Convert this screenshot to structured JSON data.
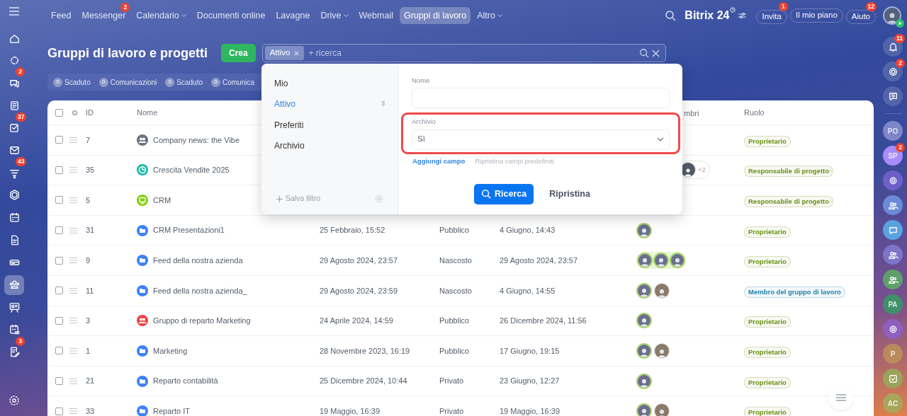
{
  "top_nav": [
    {
      "label": "Feed",
      "selected": false
    },
    {
      "label": "Messenger",
      "selected": false,
      "badge": "2"
    },
    {
      "label": "Calendario",
      "selected": false,
      "dropdown": true
    },
    {
      "label": "Documenti online",
      "selected": false
    },
    {
      "label": "Lavagne",
      "selected": false
    },
    {
      "label": "Drive",
      "selected": false,
      "dropdown": true
    },
    {
      "label": "Webmail",
      "selected": false
    },
    {
      "label": "Gruppi di lavoro",
      "selected": true
    },
    {
      "label": "Altro",
      "selected": false,
      "dropdown": true
    }
  ],
  "logo": {
    "name": "Bitrix",
    "number": "24"
  },
  "header_buttons": [
    {
      "label": "Invita",
      "badge": "1"
    },
    {
      "label": "Il mio piano"
    },
    {
      "label": "Aiuto",
      "badge": "12"
    }
  ],
  "left_sidebar": [
    {
      "kind": "home",
      "selected": false
    },
    {
      "kind": "sync",
      "selected": false
    },
    {
      "kind": "chat",
      "selected": false,
      "badge": "2"
    },
    {
      "kind": "news",
      "selected": false
    },
    {
      "kind": "tasks",
      "selected": false,
      "badge": "37"
    },
    {
      "kind": "mail",
      "selected": false
    },
    {
      "kind": "funnel",
      "selected": false,
      "badge": "43"
    },
    {
      "kind": "hexagon",
      "selected": false
    },
    {
      "kind": "calendar",
      "selected": false
    },
    {
      "kind": "document",
      "selected": false
    },
    {
      "kind": "drive",
      "selected": false
    },
    {
      "kind": "groups",
      "selected": true
    },
    {
      "kind": "board",
      "selected": false
    },
    {
      "kind": "schedule",
      "selected": false
    },
    {
      "kind": "sign",
      "selected": false,
      "badge": "3"
    }
  ],
  "page_title": "Gruppi di lavoro e progetti",
  "create_button": "Crea",
  "search": {
    "tag": "Attivo",
    "placeholder": "+ ricerca"
  },
  "counters": [
    {
      "value": "0",
      "label": "Scaduto"
    },
    {
      "value": "0",
      "label": "Comunicazioni"
    },
    {
      "value": "0",
      "label": "Scaduto"
    },
    {
      "value": "0",
      "label": "Comunica"
    }
  ],
  "filter_popup": {
    "presets": [
      {
        "label": "Mio",
        "selected": false
      },
      {
        "label": "Attivo",
        "selected": true
      },
      {
        "label": "Preferiti",
        "selected": false
      },
      {
        "label": "Archivio",
        "selected": false
      }
    ],
    "save_filter": "Salva filtro",
    "fields": [
      {
        "kind": "text",
        "label": "Nome",
        "highlighted": false
      },
      {
        "kind": "select",
        "label": "Archivio",
        "value": "Sì",
        "highlighted": true
      }
    ],
    "add_field": "Aggiungi campo",
    "reset_fields": "Ripristina campi predefiniti",
    "search_button": "Ricerca",
    "reset_button": "Ripristina"
  },
  "table": {
    "select_all_checked": false,
    "columns": [
      "ID",
      "Nome",
      "mbri",
      "Ruolo"
    ],
    "rows": [
      {
        "checked": false,
        "id": "7",
        "name": "Company news: the Vibe",
        "kind": "people",
        "color": "#6b7280",
        "role": {
          "text": "Proprietario",
          "color": "#6a8f12"
        },
        "members": []
      },
      {
        "checked": false,
        "id": "35",
        "name": "Crescita Vendite 2025",
        "kind": "chart",
        "color": "#14b8a6",
        "role": {
          "text": "Responsabile di progetto",
          "color": "#6a8f12"
        },
        "members": [
          {
            "highlighted": false,
            "kind": "silhouette"
          }
        ],
        "more": "+2"
      },
      {
        "checked": false,
        "id": "5",
        "name": "CRM",
        "kind": "screen",
        "color": "#84cc16",
        "role": {
          "text": "Responsabile di progetto",
          "color": "#6a8f12"
        },
        "members": []
      },
      {
        "checked": false,
        "id": "31",
        "name": "CRM Presentazioni1",
        "kind": "folder",
        "color": "#3b82f6",
        "created": "25 Febbraio, 15:52",
        "type": "Pubblico",
        "activity": "4 Giugno, 14:43",
        "role": {
          "text": "Proprietario",
          "color": "#6a8f12"
        },
        "members": [
          {
            "highlighted": true,
            "kind": "person"
          }
        ]
      },
      {
        "checked": false,
        "id": "9",
        "name": "Feed della nostra azienda",
        "kind": "folder",
        "color": "#3b82f6",
        "created": "29 Agosto 2024, 23:57",
        "type": "Nascosto",
        "activity": "29 Agosto 2024, 23:57",
        "role": {
          "text": "Proprietario",
          "color": "#6a8f12"
        },
        "members": [
          {
            "highlighted": true,
            "kind": "person"
          },
          {
            "highlighted": true,
            "kind": "person"
          },
          {
            "highlighted": true,
            "kind": "person"
          }
        ]
      },
      {
        "checked": false,
        "id": "11",
        "name": "Feed della nostra azienda_",
        "kind": "folder",
        "color": "#3b82f6",
        "created": "29 Agosto 2024, 23:59",
        "type": "Nascosto",
        "activity": "4 Giugno, 14:55",
        "role": {
          "text": "Membro del gruppo di lavoro",
          "color": "#1d7fa8"
        },
        "members": [
          {
            "highlighted": true,
            "kind": "person"
          },
          {
            "highlighted": false,
            "kind": "person"
          }
        ]
      },
      {
        "checked": false,
        "id": "3",
        "name": "Gruppo di reparto Marketing",
        "kind": "people",
        "color": "#ef4444",
        "created": "24 Aprile 2024, 14:59",
        "type": "Pubblico",
        "activity": "26 Dicembre 2024, 11:56",
        "role": {
          "text": "Proprietario",
          "color": "#6a8f12"
        },
        "members": [
          {
            "highlighted": true,
            "kind": "person"
          }
        ]
      },
      {
        "checked": false,
        "id": "1",
        "name": "Marketing",
        "kind": "folder",
        "color": "#3b82f6",
        "created": "28 Novembre 2023, 16:19",
        "type": "Pubblico",
        "activity": "17 Giugno, 19:15",
        "role": {
          "text": "Proprietario",
          "color": "#6a8f12"
        },
        "members": [
          {
            "highlighted": true,
            "kind": "person"
          },
          {
            "highlighted": false,
            "kind": "person"
          }
        ]
      },
      {
        "checked": false,
        "id": "21",
        "name": "Reparto contabilità",
        "kind": "folder",
        "color": "#3b82f6",
        "created": "25 Dicembre 2024, 10:44",
        "type": "Privato",
        "activity": "23 Giugno, 12:27",
        "role": {
          "text": "Proprietario",
          "color": "#6a8f12"
        },
        "members": [
          {
            "highlighted": true,
            "kind": "person"
          }
        ]
      },
      {
        "checked": false,
        "id": "33",
        "name": "Reparto IT",
        "kind": "folder",
        "color": "#3b82f6",
        "created": "19 Maggio, 16:39",
        "type": "Privato",
        "activity": "19 Maggio, 16:39",
        "role": {
          "text": "Proprietario",
          "color": "#6a8f12"
        },
        "members": [
          {
            "highlighted": true,
            "kind": "person"
          },
          {
            "highlighted": false,
            "kind": "person"
          }
        ]
      }
    ]
  },
  "right_sidebar": [
    {
      "kind": "bell",
      "badge": "11"
    },
    {
      "kind": "copilot",
      "badge": "2"
    },
    {
      "kind": "chat-search"
    },
    {
      "kind": "initials",
      "text": "PO",
      "color": "#7c86c9"
    },
    {
      "kind": "initials",
      "text": "SP",
      "color": "#a78bfa",
      "badge": "2"
    },
    {
      "kind": "swirl",
      "color": "#6d5fc9"
    },
    {
      "kind": "group",
      "color": "#6c8bd6"
    },
    {
      "kind": "chat",
      "color": "#5aa3e0"
    },
    {
      "kind": "group",
      "color": "#7b74c9"
    },
    {
      "kind": "group",
      "color": "#5fa06a"
    },
    {
      "kind": "initials",
      "text": "PA",
      "color": "#3f8f68"
    },
    {
      "kind": "swirl",
      "color": "#8d5fc0"
    },
    {
      "kind": "initials",
      "text": "P",
      "color": "#b98a5a"
    },
    {
      "kind": "check",
      "color": "#9aa35a"
    },
    {
      "kind": "initials",
      "text": "AC",
      "color": "#a8a55a"
    }
  ]
}
